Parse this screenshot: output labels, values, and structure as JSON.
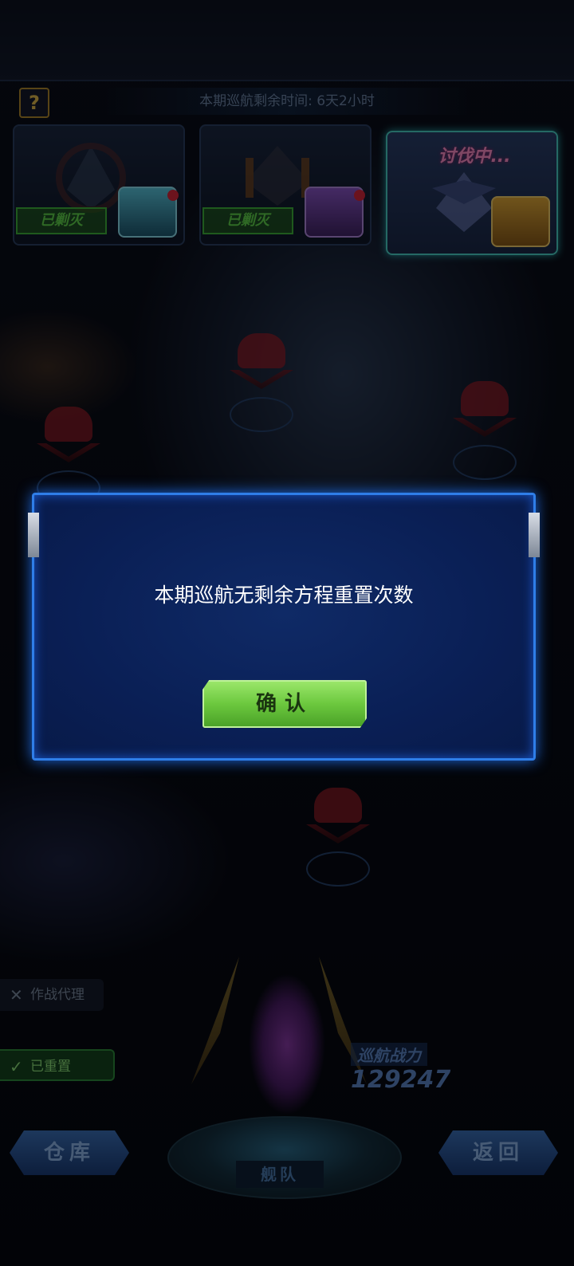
{
  "header": {
    "help_label": "?",
    "timer_text": "本期巡航剩余时间: 6天2小时"
  },
  "stages": [
    {
      "status": "已剿灭",
      "chest_color": "cyan"
    },
    {
      "status": "已剿灭",
      "chest_color": "purple"
    },
    {
      "status": "讨伐中...",
      "chest_color": "gold"
    }
  ],
  "side": {
    "agent_label": "作战代理",
    "reset_label": "已重置"
  },
  "fleet": {
    "power_label": "巡航战力",
    "power_value": "129247",
    "fleet_label": "舰队"
  },
  "bottom": {
    "warehouse_label": "仓库",
    "back_label": "返回"
  },
  "dialog": {
    "message": "本期巡航无剩余方程重置次数",
    "confirm_label": "确认"
  },
  "colors": {
    "dialog_border": "#2f7ee8",
    "dialog_bg": "#0a1f55",
    "confirm_green": "#6cc83e",
    "defeated_green": "#3fb23a"
  }
}
